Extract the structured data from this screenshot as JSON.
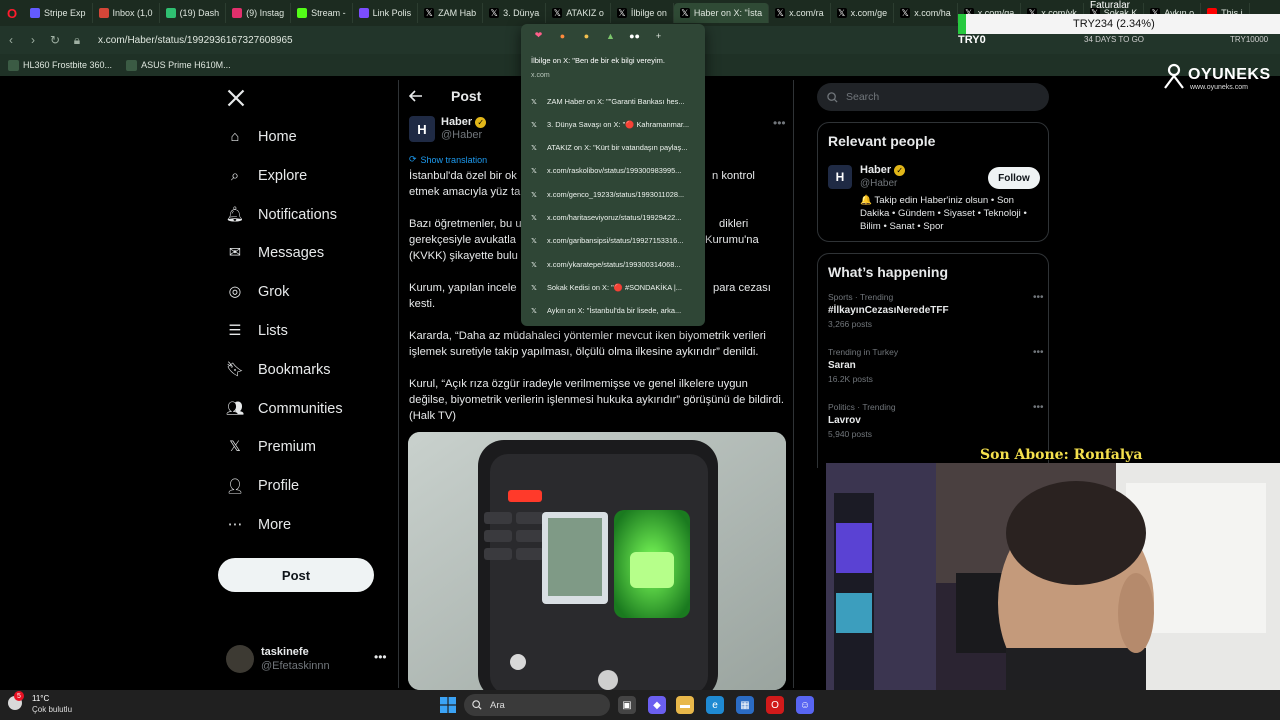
{
  "browser": {
    "tabs": [
      {
        "label": "Stripe Exp",
        "icon": "stripe-icon"
      },
      {
        "label": "Inbox (1,0",
        "icon": "mail-icon"
      },
      {
        "label": "(19) Dash",
        "icon": "dashboard-icon"
      },
      {
        "label": "(9) Instag",
        "icon": "instagram-icon"
      },
      {
        "label": "Stream -",
        "icon": "kick-icon"
      },
      {
        "label": "Link Polis",
        "icon": "link-icon"
      },
      {
        "label": "ZAM Hab",
        "icon": "x-icon"
      },
      {
        "label": "3. Dünya",
        "icon": "x-icon"
      },
      {
        "label": "ATAKIZ o",
        "icon": "x-icon"
      },
      {
        "label": "İlbilge on",
        "icon": "x-icon"
      },
      {
        "label": "Haber on X: \"İsta",
        "icon": "x-icon",
        "active": true
      },
      {
        "label": "x.com/ra",
        "icon": "x-icon"
      },
      {
        "label": "x.com/ge",
        "icon": "x-icon"
      },
      {
        "label": "x.com/ha",
        "icon": "x-icon"
      },
      {
        "label": "x.com/ga",
        "icon": "x-icon"
      },
      {
        "label": "x.com/yk",
        "icon": "x-icon"
      },
      {
        "label": "Sokak K",
        "icon": "x-icon"
      },
      {
        "label": "Aykın o",
        "icon": "x-icon"
      },
      {
        "label": "This i",
        "icon": "youtube-icon"
      }
    ],
    "url": "x.com/Haber/status/1992936167327608965",
    "bookmarks": [
      "HL360 Frostbite 360...",
      "ASUS Prime H610M..."
    ]
  },
  "overlay": {
    "faturalar": "Faturalar",
    "try_box": "TRY234 (2.34%)",
    "try0": "TRY0",
    "days": "34 DAYS TO GO",
    "try_goal": "TRY10000",
    "brand": "OYUNEKS",
    "brand_url": "www.oyuneks.com",
    "sub_label": "Son Abone: Ronfalya"
  },
  "sidebar": {
    "items": [
      {
        "label": "Home",
        "icon": "home-icon"
      },
      {
        "label": "Explore",
        "icon": "search-icon"
      },
      {
        "label": "Notifications",
        "icon": "bell-icon"
      },
      {
        "label": "Messages",
        "icon": "mail-icon"
      },
      {
        "label": "Grok",
        "icon": "grok-icon"
      },
      {
        "label": "Lists",
        "icon": "list-icon"
      },
      {
        "label": "Bookmarks",
        "icon": "bookmark-icon"
      },
      {
        "label": "Communities",
        "icon": "people-icon"
      },
      {
        "label": "Premium",
        "icon": "x-icon"
      },
      {
        "label": "Profile",
        "icon": "person-icon"
      },
      {
        "label": "More",
        "icon": "more-circle-icon"
      }
    ],
    "post_label": "Post",
    "user": {
      "name": "taskinefe",
      "handle": "@Efetaskinnn"
    }
  },
  "post": {
    "header": "Post",
    "author_name": "Haber",
    "author_handle": "@Haber",
    "show_translation": "Show translation",
    "p1a": "İstanbul'da özel bir ok",
    "p1b": "n kontrol",
    "p1c": "etmek amacıyla yüz ta",
    "p2a": "Bazı öğretmenler, bu u",
    "p2b": "dikleri",
    "p2c": "gerekçesiyle avukatla",
    "p2d": "Kurumu'na",
    "p2e": "(KVKK) şikayette bulu",
    "p3a": "Kurum, yapılan incele",
    "p3b": "para cezası",
    "p3c": "kesti.",
    "p4": "Kararda, “Daha az müdahaleci yöntemler mevcut iken biyometrik verileri işlemek suretiyle takip yapılması, ölçülü olma ilkesine aykırıdır” denildi.",
    "p5": "Kurul, “Açık rıza özgür iradeyle verilmemişse ve genel ilkelere uygun değilse, biyometrik verilerin işlenmesi hukuka aykırıdır” görüşünü de bildirdi. (Halk TV)"
  },
  "right": {
    "search_placeholder": "Search",
    "relevant_title": "Relevant people",
    "person": {
      "name": "Haber",
      "handle": "@Haber",
      "bio": "🔔 Takip edin Haber'iniz olsun • Son Dakika • Gündem • Siyaset • Teknoloji • Bilim • Sanat • Spor",
      "follow_label": "Follow"
    },
    "happening_title": "What’s happening",
    "trends": [
      {
        "meta": "Sports · Trending",
        "name": "#İlkayınCezasıNeredeTFF",
        "posts": "3,266 posts"
      },
      {
        "meta": "Trending in Turkey",
        "name": "Saran",
        "posts": "16.2K posts"
      },
      {
        "meta": "Politics · Trending",
        "name": "Lavrov",
        "posts": "5,940 posts"
      }
    ]
  },
  "tab_menu": {
    "preview_title": "İlbilge on X: \"Ben de bir ek bilgi vereyim.",
    "preview_url": "x.com",
    "items": [
      "ZAM Haber on X: \"\"Garanti Bankası hes...",
      "3. Dünya Savaşı on X: \"🔴 Kahramanmar...",
      "ATAKIZ on X: \"Kürt bir vatandaşın paylaş...",
      "x.com/raskolibov/status/199300983995...",
      "x.com/genco_19233/status/1993011028...",
      "x.com/haritaseviyoruz/status/19929422...",
      "x.com/garibansipsi/status/19927153316...",
      "x.com/ykaratepe/status/199300314068...",
      "Sokak Kedisi on X: \"🔴 #SONDAKİKA |...",
      "Aykın on X: \"İstanbul'da bir lisede, arka..."
    ]
  },
  "taskbar": {
    "temp": "11°C",
    "weather": "Çok bulutlu",
    "weather_badge": "5",
    "search_placeholder": "Ara"
  }
}
